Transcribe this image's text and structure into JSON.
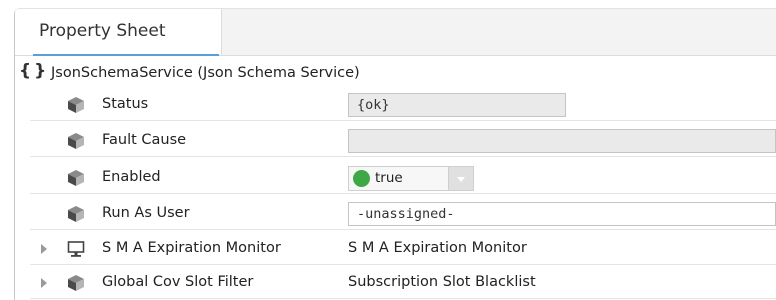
{
  "tab": {
    "label": "Property Sheet"
  },
  "root": {
    "label": "JsonSchemaService  (Json Schema Service)",
    "icon": "json-braces-icon"
  },
  "properties": [
    {
      "name": "Status",
      "value": "{ok}",
      "icon": "slot-box-icon"
    },
    {
      "name": "Fault Cause",
      "value": "",
      "icon": "slot-box-icon"
    },
    {
      "name": "Enabled",
      "value": "true",
      "icon": "slot-box-icon",
      "status_color": "#3ea846"
    },
    {
      "name": "Run As User",
      "value": "-unassigned-",
      "icon": "slot-box-icon"
    },
    {
      "name": "S M A Expiration Monitor",
      "value": "S M A Expiration Monitor",
      "icon": "monitor-icon"
    },
    {
      "name": "Global Cov Slot Filter",
      "value": "Subscription Slot Blacklist",
      "icon": "slot-box-icon"
    }
  ]
}
